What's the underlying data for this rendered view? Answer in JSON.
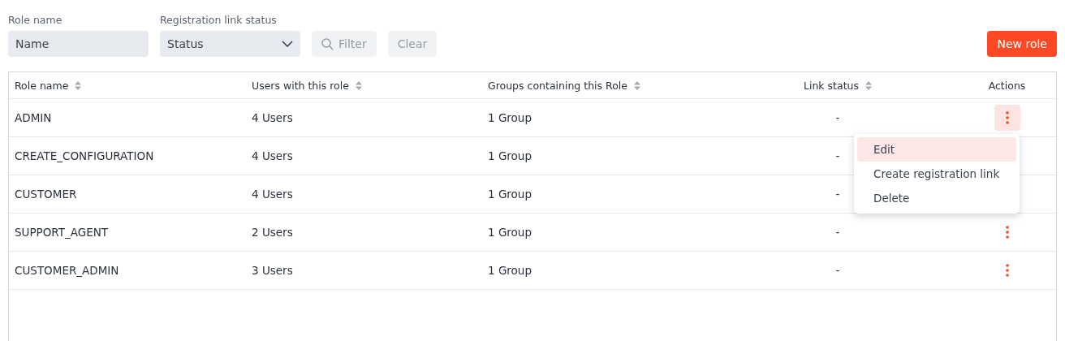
{
  "filters": {
    "role_name": {
      "label": "Role name",
      "placeholder": "Name"
    },
    "link_status": {
      "label": "Registration link status",
      "value": "Status"
    },
    "filter_button": {
      "label": "Filter",
      "disabled": true
    },
    "clear_button": {
      "label": "Clear",
      "disabled": true
    }
  },
  "new_role_button": "New role",
  "table": {
    "columns": [
      {
        "label": "Role name",
        "sortable": true
      },
      {
        "label": "Users with this role",
        "sortable": true
      },
      {
        "label": "Groups containing this Role",
        "sortable": true
      },
      {
        "label": "Link status",
        "sortable": true
      },
      {
        "label": "Actions",
        "sortable": false
      }
    ],
    "rows": [
      {
        "role": "ADMIN",
        "users": "4 Users",
        "groups": "1 Group",
        "link_status": "-",
        "actions": {
          "active": true
        }
      },
      {
        "role": "CREATE_CONFIGURATION",
        "users": "4 Users",
        "groups": "1 Group",
        "link_status": "-"
      },
      {
        "role": "CUSTOMER",
        "users": "4 Users",
        "groups": "1 Group",
        "link_status": "-"
      },
      {
        "role": "SUPPORT_AGENT",
        "users": "2 Users",
        "groups": "1 Group",
        "link_status": "-",
        "actions": {
          "active": false
        }
      },
      {
        "role": "CUSTOMER_ADMIN",
        "users": "3 Users",
        "groups": "1 Group",
        "link_status": "-",
        "actions": {
          "active": false
        }
      }
    ]
  },
  "actions_menu": {
    "items": [
      {
        "label": "Edit",
        "selected": true
      },
      {
        "label": "Create registration link",
        "selected": false
      },
      {
        "label": "Delete",
        "selected": false
      }
    ]
  }
}
